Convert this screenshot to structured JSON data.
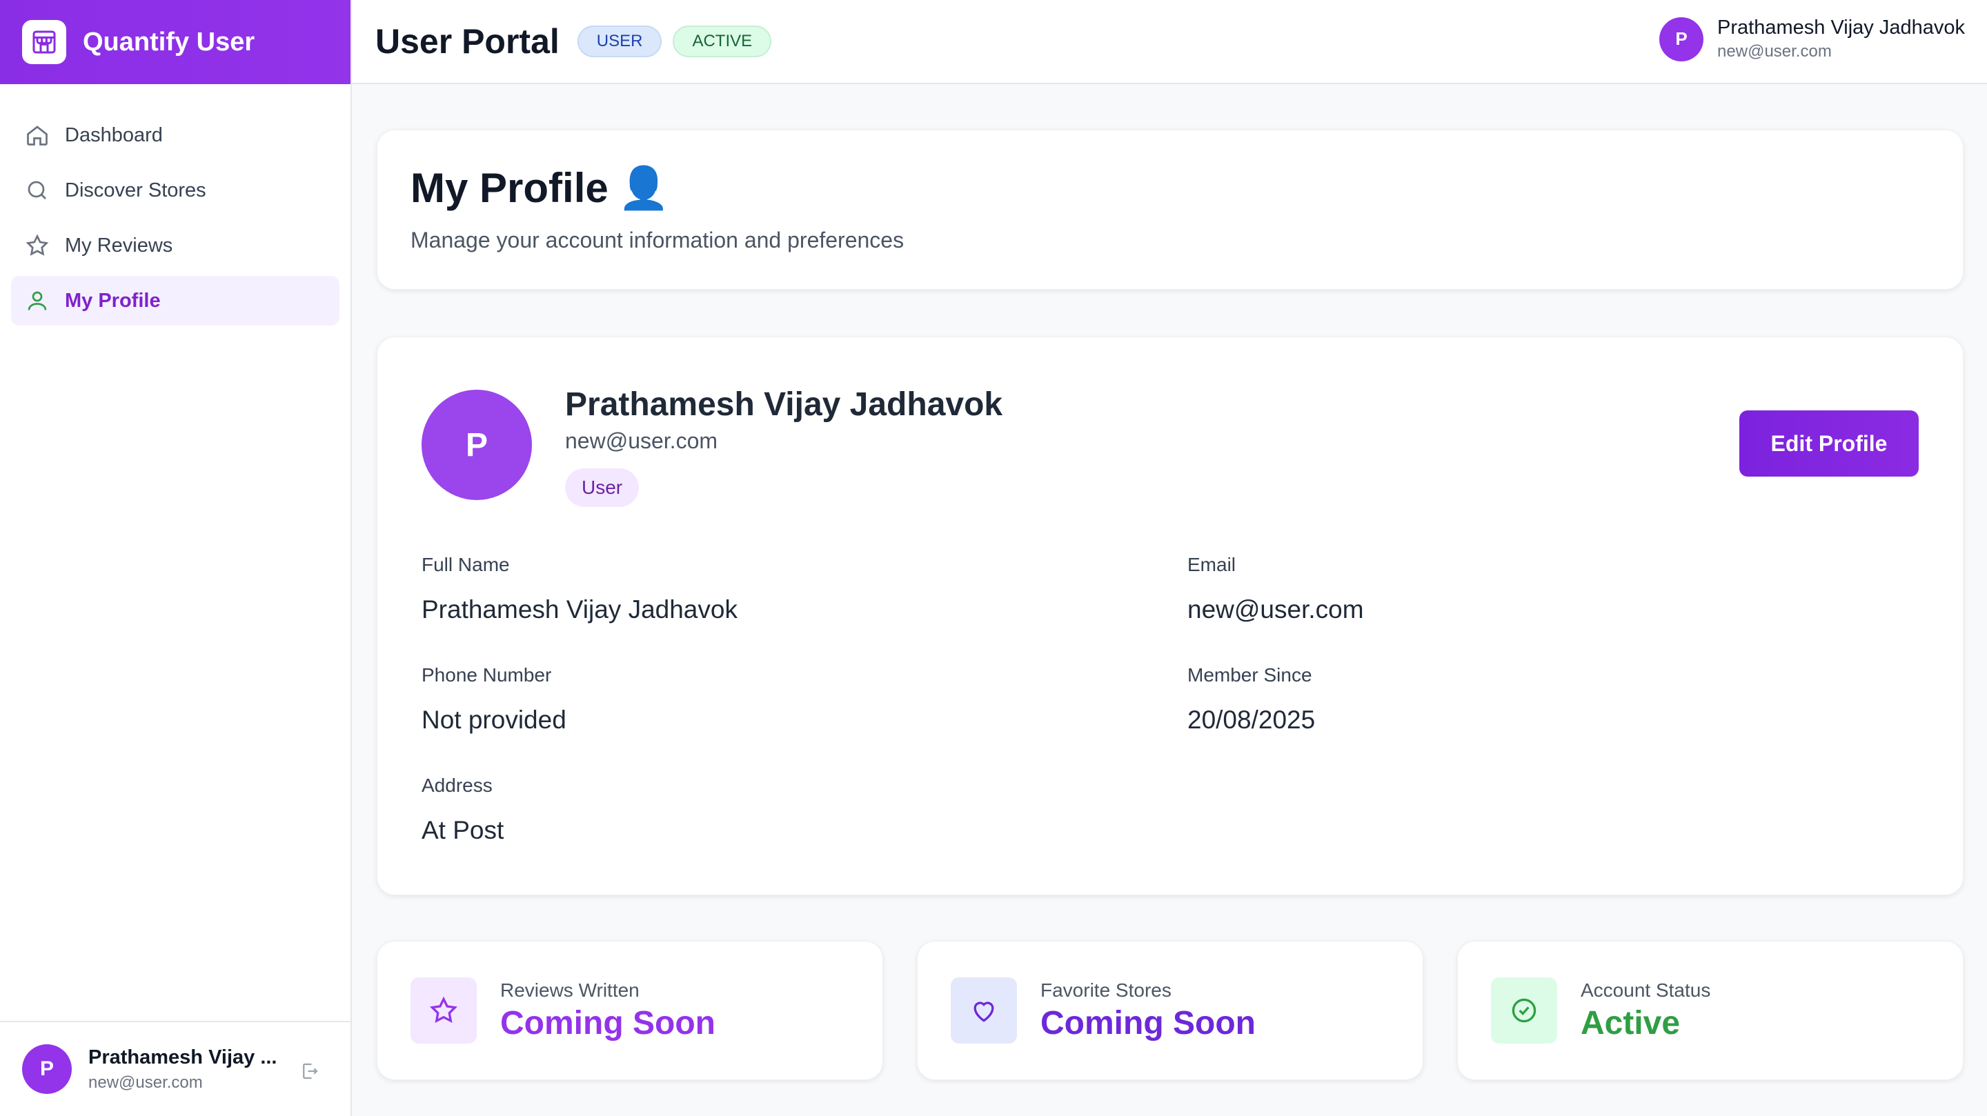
{
  "brand": {
    "name": "Quantify User",
    "icon": "store-icon"
  },
  "sidebar": {
    "items": [
      {
        "label": "Dashboard",
        "icon": "home-icon"
      },
      {
        "label": "Discover Stores",
        "icon": "search-icon"
      },
      {
        "label": "My Reviews",
        "icon": "star-icon"
      },
      {
        "label": "My Profile",
        "icon": "user-icon",
        "active": true
      }
    ],
    "user": {
      "initial": "P",
      "name": "Prathamesh Vijay ...",
      "email": "new@user.com"
    }
  },
  "header": {
    "title": "User Portal",
    "badges": [
      "USER",
      "ACTIVE"
    ],
    "user": {
      "initial": "P",
      "name": "Prathamesh Vijay Jadhavok",
      "email": "new@user.com"
    }
  },
  "page": {
    "title": "My Profile",
    "emoji": "👤",
    "subtitle": "Manage your account information and preferences"
  },
  "profile": {
    "initial": "P",
    "name": "Prathamesh Vijay Jadhavok",
    "email": "new@user.com",
    "role": "User",
    "edit_label": "Edit Profile",
    "fields": {
      "full_name": {
        "label": "Full Name",
        "value": "Prathamesh Vijay Jadhavok"
      },
      "email": {
        "label": "Email",
        "value": "new@user.com"
      },
      "phone": {
        "label": "Phone Number",
        "value": "Not provided"
      },
      "member_since": {
        "label": "Member Since",
        "value": "20/08/2025"
      },
      "address": {
        "label": "Address",
        "value": "At Post"
      }
    }
  },
  "stats": [
    {
      "label": "Reviews Written",
      "value": "Coming Soon",
      "icon": "star-icon",
      "color": "#9333ea"
    },
    {
      "label": "Favorite Stores",
      "value": "Coming Soon",
      "icon": "heart-icon",
      "color": "#6d28d9"
    },
    {
      "label": "Account Status",
      "value": "Active",
      "icon": "check-circle-icon",
      "color": "#2f9e44"
    }
  ],
  "colors": {
    "accent": "#8b2be2",
    "active_green": "#2f9e44"
  }
}
